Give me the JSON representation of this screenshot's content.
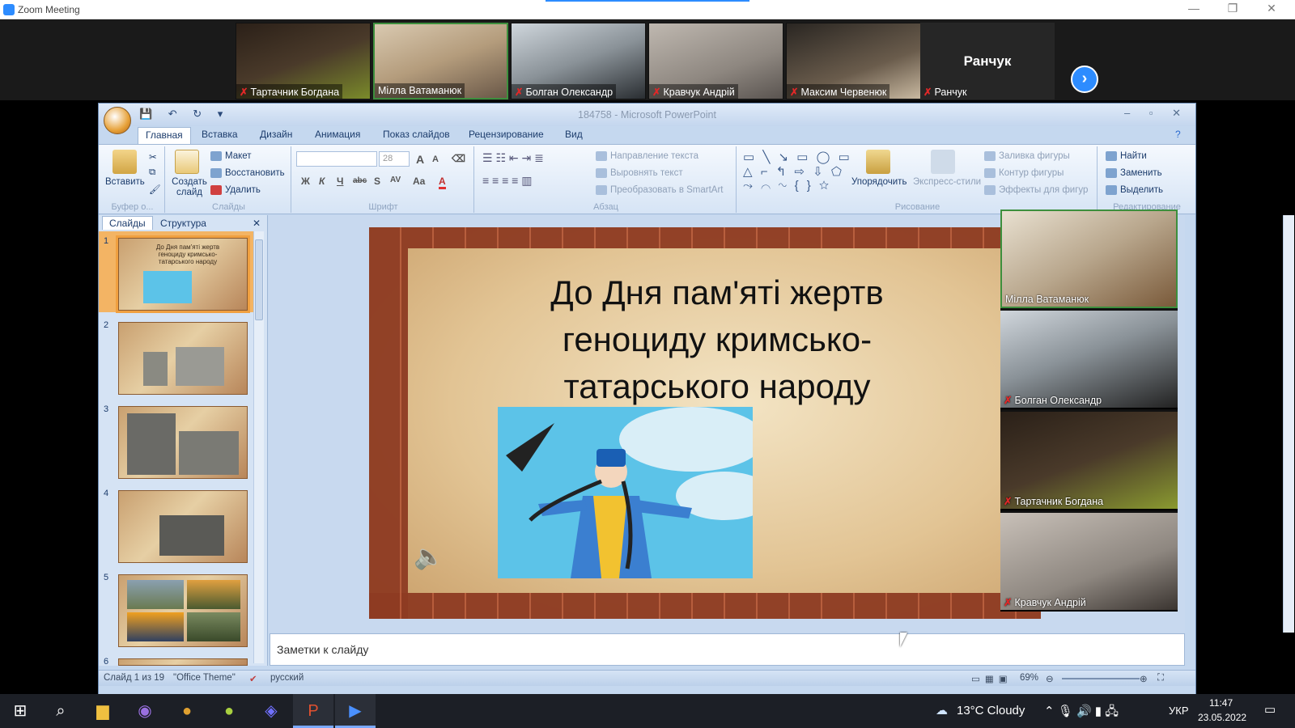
{
  "zoom": {
    "window_title": "Zoom Meeting",
    "controls": {
      "minimize": "—",
      "restore": "❐",
      "close": "✕"
    },
    "participants_strip": [
      {
        "name": "Тартачник Богдана",
        "muted": true
      },
      {
        "name": "Мілла Ватаманюк",
        "muted": false,
        "active": true
      },
      {
        "name": "Болган Олександр",
        "muted": true
      },
      {
        "name": "Кравчук Андрій",
        "muted": true
      },
      {
        "name": "Максим Червенюк",
        "muted": true
      },
      {
        "name": "Ранчук",
        "muted": true
      }
    ],
    "text_tile_name": "Ранчук",
    "next_page_icon": "›",
    "side_videos": [
      {
        "name": "Мілла Ватаманюк",
        "muted": false,
        "active": true
      },
      {
        "name": "Болган Олександр",
        "muted": true
      },
      {
        "name": "Тартачник Богдана",
        "muted": true
      },
      {
        "name": "Кравчук Андрій",
        "muted": true
      }
    ]
  },
  "powerpoint": {
    "title": "184758 - Microsoft PowerPoint",
    "qat_icons": "💾 ↶ ↻ ▾",
    "tabs": [
      "Главная",
      "Вставка",
      "Дизайн",
      "Анимация",
      "Показ слайдов",
      "Рецензирование",
      "Вид"
    ],
    "ribbon": {
      "clipboard": {
        "paste": "Вставить",
        "group": "Буфер о..."
      },
      "slides": {
        "new_slide": "Создать слайд",
        "layout": "Макет",
        "reset": "Восстановить",
        "delete": "Удалить",
        "group": "Слайды"
      },
      "font": {
        "size": "28",
        "group": "Шрифт",
        "bold": "Ж",
        "italic": "К",
        "underline": "Ч",
        "strike": "abc",
        "shadow": "S",
        "spacing": "AV",
        "case": "Aa",
        "color": "A",
        "grow": "A",
        "shrink": "A"
      },
      "paragraph": {
        "direction": "Направление текста",
        "align": "Выровнять текст",
        "smartart": "Преобразовать в SmartArt",
        "group": "Абзац"
      },
      "drawing": {
        "arrange": "Упорядочить",
        "quick_styles": "Экспресс-стили",
        "fill": "Заливка фигуры",
        "outline": "Контур фигуры",
        "effects": "Эффекты для фигур",
        "group": "Рисование"
      },
      "editing": {
        "find": "Найти",
        "replace": "Заменить",
        "select": "Выделить",
        "group": "Редактирование"
      }
    },
    "panel_tabs": [
      "Слайды",
      "Структура"
    ],
    "thumbnails": [
      {
        "num": "1",
        "text": "До Дня пам'яті жертв геноциду кримсько-татарського народу"
      },
      {
        "num": "2",
        "text": ""
      },
      {
        "num": "3",
        "text": ""
      },
      {
        "num": "4",
        "text": ""
      },
      {
        "num": "5",
        "text": ""
      },
      {
        "num": "6",
        "text": ""
      }
    ],
    "slide": {
      "title_line1": "До Дня пам'яті жертв",
      "title_line2": "геноциду кримсько-",
      "title_line3": "татарського народу"
    },
    "notes_placeholder": "Заметки к слайду",
    "status": {
      "slide_info": "Слайд 1 из 19",
      "theme": "\"Office Theme\"",
      "language": "русский",
      "zoom": "69%"
    }
  },
  "taskbar": {
    "weather": "13°C  Cloudy",
    "language": "УКР",
    "time": "11:47",
    "date": "23.05.2022",
    "apps": [
      "start",
      "search",
      "file-explorer",
      "viber",
      "chrome",
      "app-green",
      "app-game",
      "powerpoint",
      "zoom"
    ]
  }
}
